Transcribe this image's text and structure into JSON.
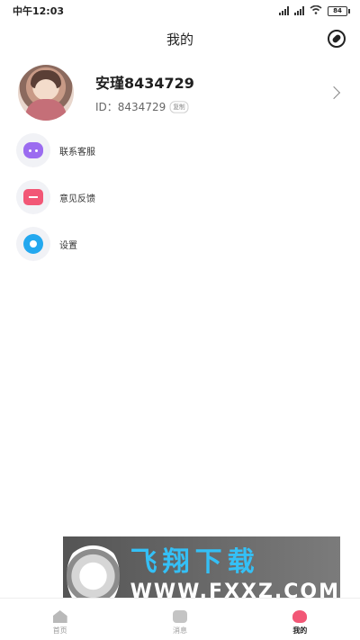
{
  "status_bar": {
    "time": "中午12:03",
    "battery": "84"
  },
  "header": {
    "title": "我的"
  },
  "profile": {
    "name": "安瑾8434729",
    "id_text": "ID：8434729",
    "id_badge": "复制"
  },
  "menu": [
    {
      "label": "联系客服",
      "icon": "chat-icon",
      "color": "#9b6cf0"
    },
    {
      "label": "意见反馈",
      "icon": "feedback-icon",
      "color": "#f25776"
    },
    {
      "label": "设置",
      "icon": "settings-icon",
      "color": "#23a8ef"
    }
  ],
  "watermark": {
    "title": "飞翔下载",
    "url": "WWW.FXXZ.COM"
  },
  "tabs": [
    {
      "label": "首页",
      "icon": "home-icon",
      "active": false
    },
    {
      "label": "消息",
      "icon": "message-icon",
      "active": false
    },
    {
      "label": "我的",
      "icon": "profile-icon",
      "active": true
    }
  ]
}
